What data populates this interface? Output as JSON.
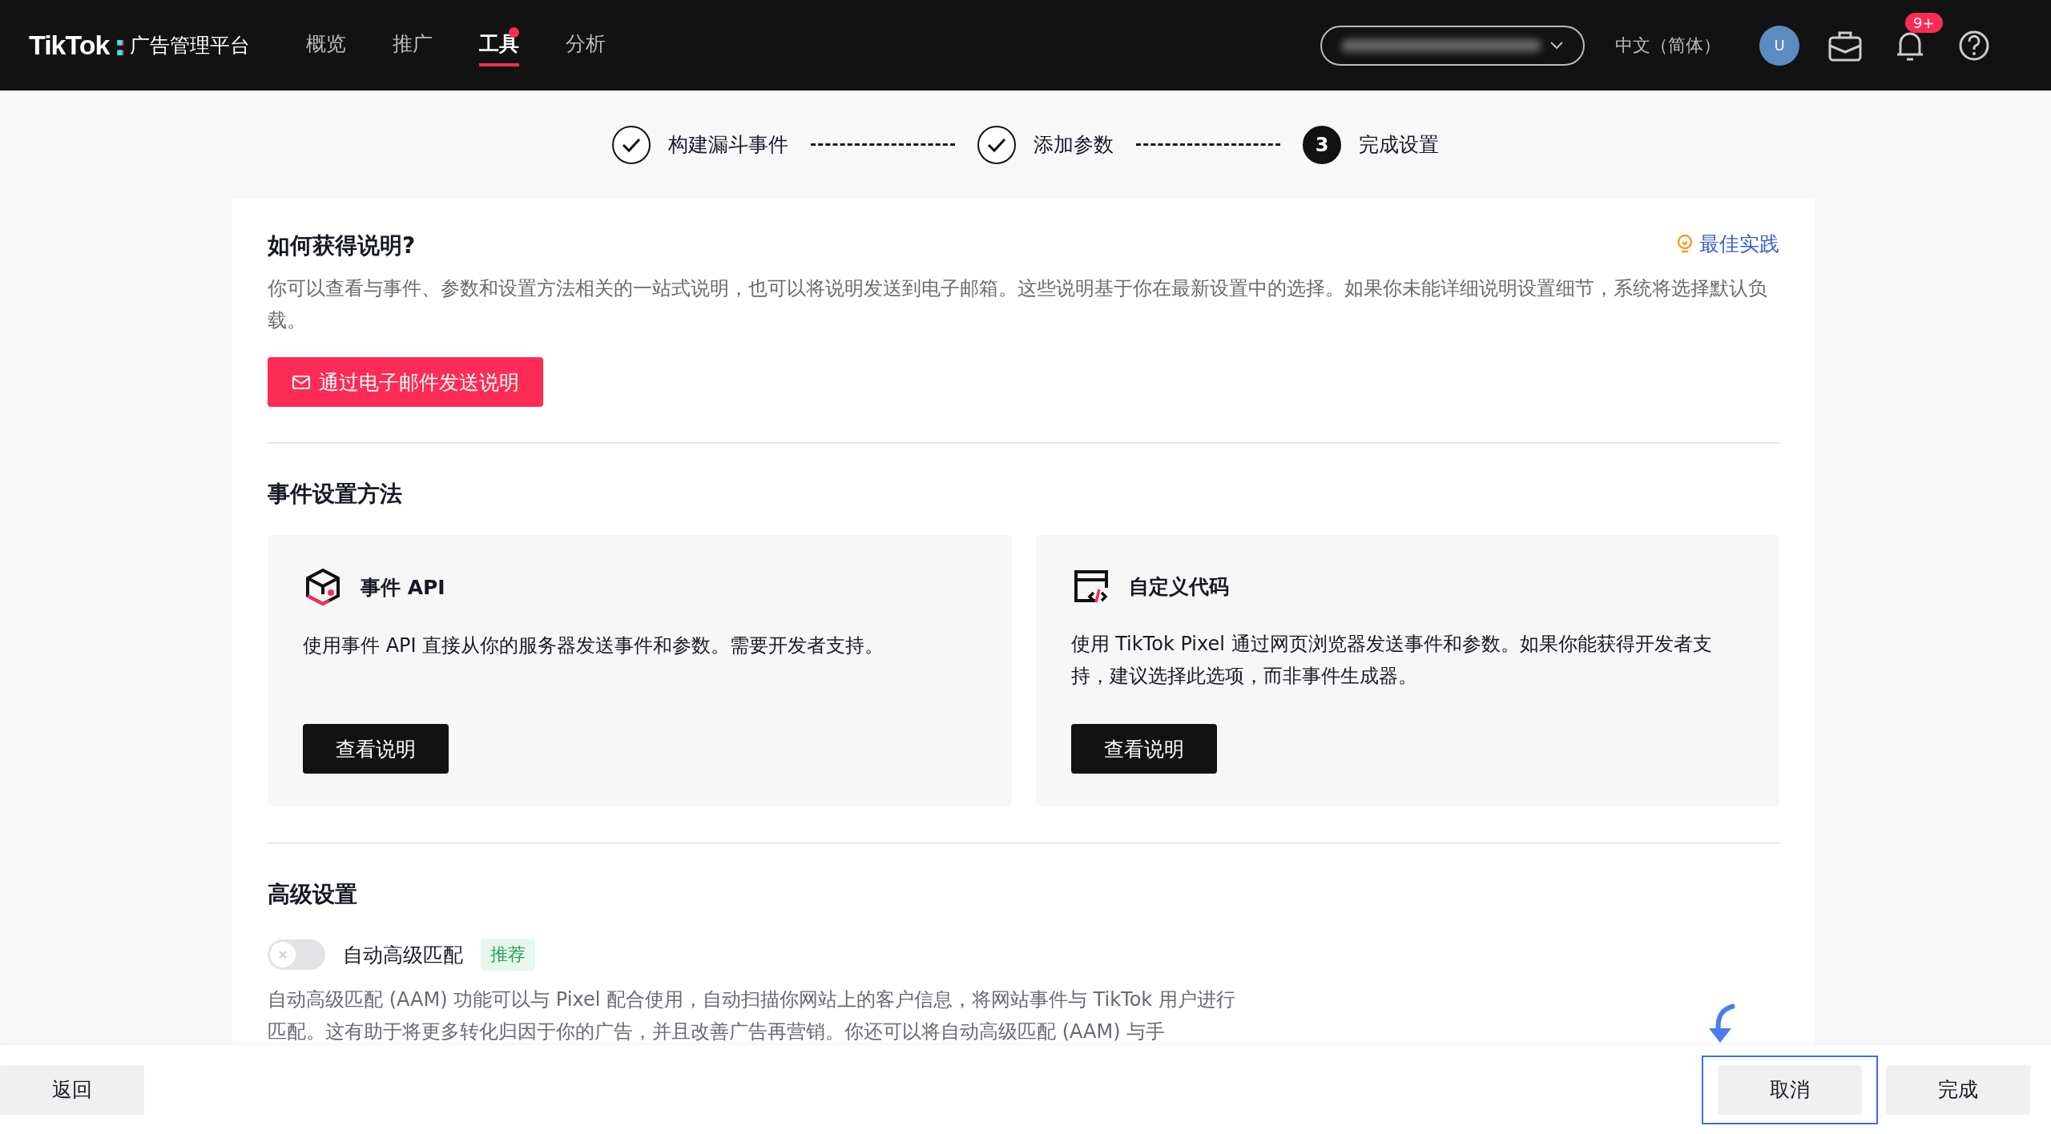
{
  "header": {
    "logo": "TikTok",
    "logo_mark": ":",
    "product": "广告管理平台",
    "nav": [
      {
        "label": "概览",
        "selected": false,
        "dot": false
      },
      {
        "label": "推广",
        "selected": false,
        "dot": false
      },
      {
        "label": "工具",
        "selected": true,
        "dot": true
      },
      {
        "label": "分析",
        "selected": false,
        "dot": false
      }
    ],
    "language": "中文（简体）",
    "avatar": "U",
    "notification_badge": "9+"
  },
  "steps": [
    {
      "label": "构建漏斗事件",
      "kind": "done"
    },
    {
      "label": "添加参数",
      "kind": "done"
    },
    {
      "label": "完成设置",
      "kind": "current",
      "number": "3"
    }
  ],
  "instructions": {
    "title": "如何获得说明?",
    "link": "最佳实践",
    "text": "你可以查看与事件、参数和设置方法相关的一站式说明，也可以将说明发送到电子邮箱。这些说明基于你在最新设置中的选择。如果你未能详细说明设置细节，系统将选择默认负载。",
    "button": "通过电子邮件发送说明"
  },
  "methods": {
    "title": "事件设置方法",
    "cards": [
      {
        "kind": "api",
        "title": "事件 API",
        "text": "使用事件 API 直接从你的服务器发送事件和参数。需要开发者支持。",
        "button": "查看说明"
      },
      {
        "kind": "code",
        "title": "自定义代码",
        "text": "使用 TikTok Pixel 通过网页浏览器发送事件和参数。如果你能获得开发者支持，建议选择此选项，而非事件生成器。",
        "button": "查看说明"
      }
    ]
  },
  "advanced": {
    "title": "高级设置",
    "toggle": {
      "label": "自动高级匹配",
      "checked": false,
      "tag": "推荐"
    },
    "text": "自动高级匹配 (AAM) 功能可以与 Pixel 配合使用，自动扫描你网站上的客户信息，将网站事件与 TikTok 用户进行匹配。这有助于将更多转化归因于你的广告，并且改善广告再营销。你还可以将自动高级匹配 (AAM) 与手"
  },
  "footer": {
    "back": "返回",
    "cancel": "取消",
    "done": "完成"
  }
}
